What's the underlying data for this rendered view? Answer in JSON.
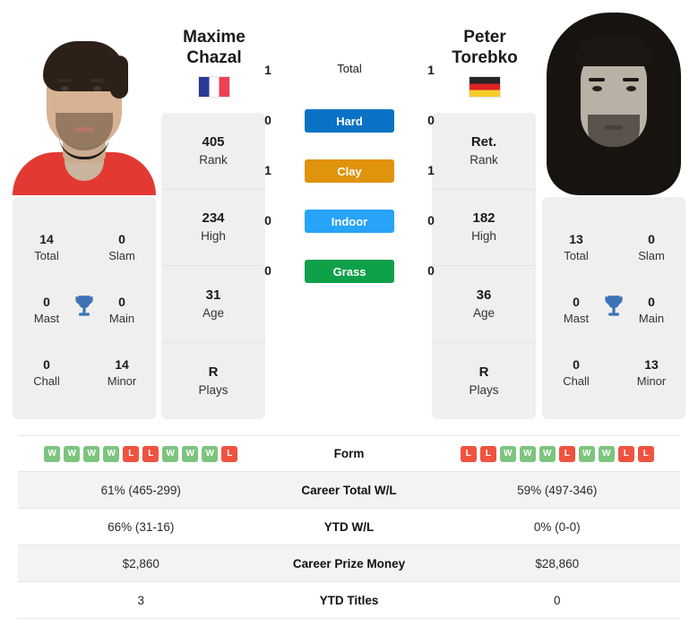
{
  "players": {
    "left": {
      "first_name": "Maxime",
      "last_name": "Chazal",
      "full_name": "Maxime Chazal",
      "flag": "flag-fr",
      "country": "France",
      "rank": "405",
      "rank_label": "Rank",
      "high": "234",
      "high_label": "High",
      "age": "31",
      "age_label": "Age",
      "plays": "R",
      "plays_label": "Plays",
      "titles": {
        "total": "14",
        "total_label": "Total",
        "slam": "0",
        "slam_label": "Slam",
        "mast": "0",
        "mast_label": "Mast",
        "main": "0",
        "main_label": "Main",
        "chall": "0",
        "chall_label": "Chall",
        "minor": "14",
        "minor_label": "Minor"
      },
      "surface_wins": {
        "total": "1",
        "hard": "0",
        "clay": "1",
        "indoor": "0",
        "grass": "0"
      },
      "form": [
        "W",
        "W",
        "W",
        "W",
        "L",
        "L",
        "W",
        "W",
        "W",
        "L"
      ],
      "career_wl": "61% (465-299)",
      "ytd_wl": "66% (31-16)",
      "career_prize": "$2,860",
      "ytd_titles": "3"
    },
    "right": {
      "first_name": "Peter",
      "last_name": "Torebko",
      "full_name": "Peter Torebko",
      "flag": "flag-de",
      "country": "Germany",
      "rank": "Ret.",
      "rank_label": "Rank",
      "high": "182",
      "high_label": "High",
      "age": "36",
      "age_label": "Age",
      "plays": "R",
      "plays_label": "Plays",
      "titles": {
        "total": "13",
        "total_label": "Total",
        "slam": "0",
        "slam_label": "Slam",
        "mast": "0",
        "mast_label": "Mast",
        "main": "0",
        "main_label": "Main",
        "chall": "0",
        "chall_label": "Chall",
        "minor": "13",
        "minor_label": "Minor"
      },
      "surface_wins": {
        "total": "1",
        "hard": "0",
        "clay": "1",
        "indoor": "0",
        "grass": "0"
      },
      "form": [
        "L",
        "L",
        "W",
        "W",
        "W",
        "L",
        "W",
        "W",
        "L",
        "L"
      ],
      "career_wl": "59% (497-346)",
      "ytd_wl": "0% (0-0)",
      "career_prize": "$28,860",
      "ytd_titles": "0"
    }
  },
  "surfaces": [
    {
      "key": "total",
      "label": "Total",
      "style": "plain",
      "color": ""
    },
    {
      "key": "hard",
      "label": "Hard",
      "style": "badge",
      "color": "#0a72c4"
    },
    {
      "key": "clay",
      "label": "Clay",
      "style": "badge",
      "color": "#e0930d"
    },
    {
      "key": "indoor",
      "label": "Indoor",
      "style": "badge",
      "color": "#27a3f7"
    },
    {
      "key": "grass",
      "label": "Grass",
      "style": "badge",
      "color": "#0fa04a"
    }
  ],
  "table": {
    "rows": [
      {
        "label": "Form",
        "left": "",
        "right": "",
        "type": "form"
      },
      {
        "label": "Career Total W/L",
        "left": "61% (465-299)",
        "right": "59% (497-346)",
        "type": "text"
      },
      {
        "label": "YTD W/L",
        "left": "66% (31-16)",
        "right": "0% (0-0)",
        "type": "text"
      },
      {
        "label": "Career Prize Money",
        "left": "$2,860",
        "right": "$28,860",
        "type": "text"
      },
      {
        "label": "YTD Titles",
        "left": "3",
        "right": "0",
        "type": "text"
      }
    ]
  },
  "colors": {
    "win": "#7dc47f",
    "loss": "#ef5340",
    "panel": "#efefef",
    "stripe": "#f3f3f3",
    "trophy": "#3d73b5"
  }
}
